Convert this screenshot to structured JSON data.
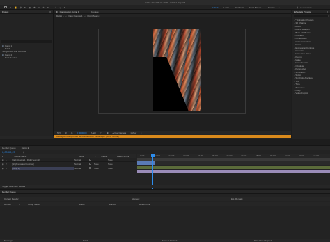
{
  "app": {
    "title": "Adobe After Effects 2020 - Untitled Project *",
    "workspaces": [
      "Default",
      "Learn",
      "Standard",
      "Small Screen",
      "Libraries"
    ],
    "active_workspace": "Default",
    "search_help_placeholder": "Search Help"
  },
  "project_panel": {
    "tab": "Project",
    "items": [
      "Comp 1",
      "Solids",
      "Brightness And Contrast",
      "Comp 2",
      "Final Render"
    ]
  },
  "composition_panel": {
    "tabs": [
      "Composition Comp 1",
      "Footage"
    ],
    "breadcrumb": [
      "Comp 1",
      "Dark Roughs 1",
      "Flight Seam 1"
    ],
    "viewer_tab": "Comp 1",
    "zoom": "50%",
    "resolution": "(Half)",
    "timecode": "0;00;00;00",
    "camera": "Active Camera",
    "views": "1 View",
    "status_bar": "Adding an unsupported file to a selection mode layer (set to normal)"
  },
  "effects_panel": {
    "tab": "Effects & Presets",
    "search_placeholder": "",
    "items": [
      "* Animation Presets",
      "3D Channel",
      "Audio",
      "Blur & Sharpen",
      "Boris FX Mocha",
      "Channel",
      "CINEMA 4D",
      "Color Correction",
      "Distort",
      "Expression Controls",
      "Generate",
      "Immersive Video",
      "Keying",
      "Matte",
      "Noise & Grain",
      "Obsolete",
      "Perspective",
      "Simulation",
      "Stylize",
      "Synthetic Aperture",
      "Text",
      "Time",
      "Transition",
      "Utility",
      "Video Copilot"
    ]
  },
  "timeline": {
    "tabs": [
      "Render Queue",
      "Comp 1"
    ],
    "timecode": "0;00;00;23",
    "columns": [
      "#",
      "Source Name",
      "Mode",
      "T",
      "TrkMat",
      "Parent & Link"
    ],
    "layers": [
      {
        "num": "1",
        "name": "[Dark Roughs 1 - Flight Seam 1]",
        "mode": "Normal",
        "trkmat": "",
        "parent": "None"
      },
      {
        "num": "2",
        "name": "[Brightness and Contrast]",
        "mode": "Normal",
        "trkmat": "None",
        "parent": "None"
      },
      {
        "num": "3",
        "name": "[Comp 2]",
        "mode": "Normal",
        "trkmat": "None",
        "parent": "None"
      }
    ],
    "ruler": [
      "0:00f",
      "01:00f",
      "02:00f",
      "03:00f",
      "04:00f",
      "05:00f",
      "06:00f",
      "07:00f",
      "08:00f",
      "09:00f",
      "10:00f",
      "11:00f",
      "12:00f"
    ],
    "bottom_label": "Toggle Switches / Modes"
  },
  "render_queue": {
    "tab": "Render Queue",
    "columns": [
      "Current Render",
      "Elapsed:",
      "Est. Remain:"
    ],
    "table_cols": [
      "Render",
      "#",
      "Comp Name",
      "Status",
      "Started",
      "Render Time"
    ],
    "footer": [
      "Message:",
      "RAM:",
      "Renders Started:",
      "Total Time Elapsed:"
    ]
  },
  "colors": {
    "accent": "#2d8ceb",
    "warning_bar": "#d98a1c",
    "panel": "#232323",
    "bg": "#1d1d1d"
  }
}
